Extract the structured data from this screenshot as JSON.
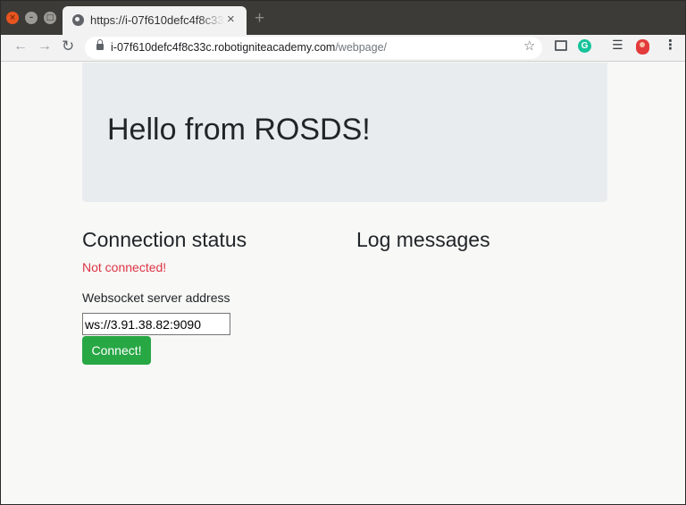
{
  "browser": {
    "tab_title": "https://i-07f610defc4f8c33c.robotigniteacademy.com/webpage/",
    "url_host": "i-07f610defc4f8c33c.robotigniteacademy.com",
    "url_path": "/webpage/",
    "icons": {
      "close": "close-icon",
      "minimize": "minimize-icon",
      "maximize": "maximize-icon",
      "new_tab": "plus-icon",
      "back": "arrow-left-icon",
      "forward": "arrow-right-icon",
      "reload": "reload-icon",
      "bookmark": "star-icon",
      "menu": "kebab-icon"
    }
  },
  "jumbotron": {
    "heading": "Hello from ROSDS!"
  },
  "connection": {
    "heading": "Connection status",
    "status_text": "Not connected!",
    "status_color": "#dc3545",
    "address_label": "Websocket server address",
    "address_value": "ws://3.91.38.82:9090",
    "connect_label": "Connect!",
    "connect_color": "#28a745"
  },
  "log": {
    "heading": "Log messages"
  }
}
